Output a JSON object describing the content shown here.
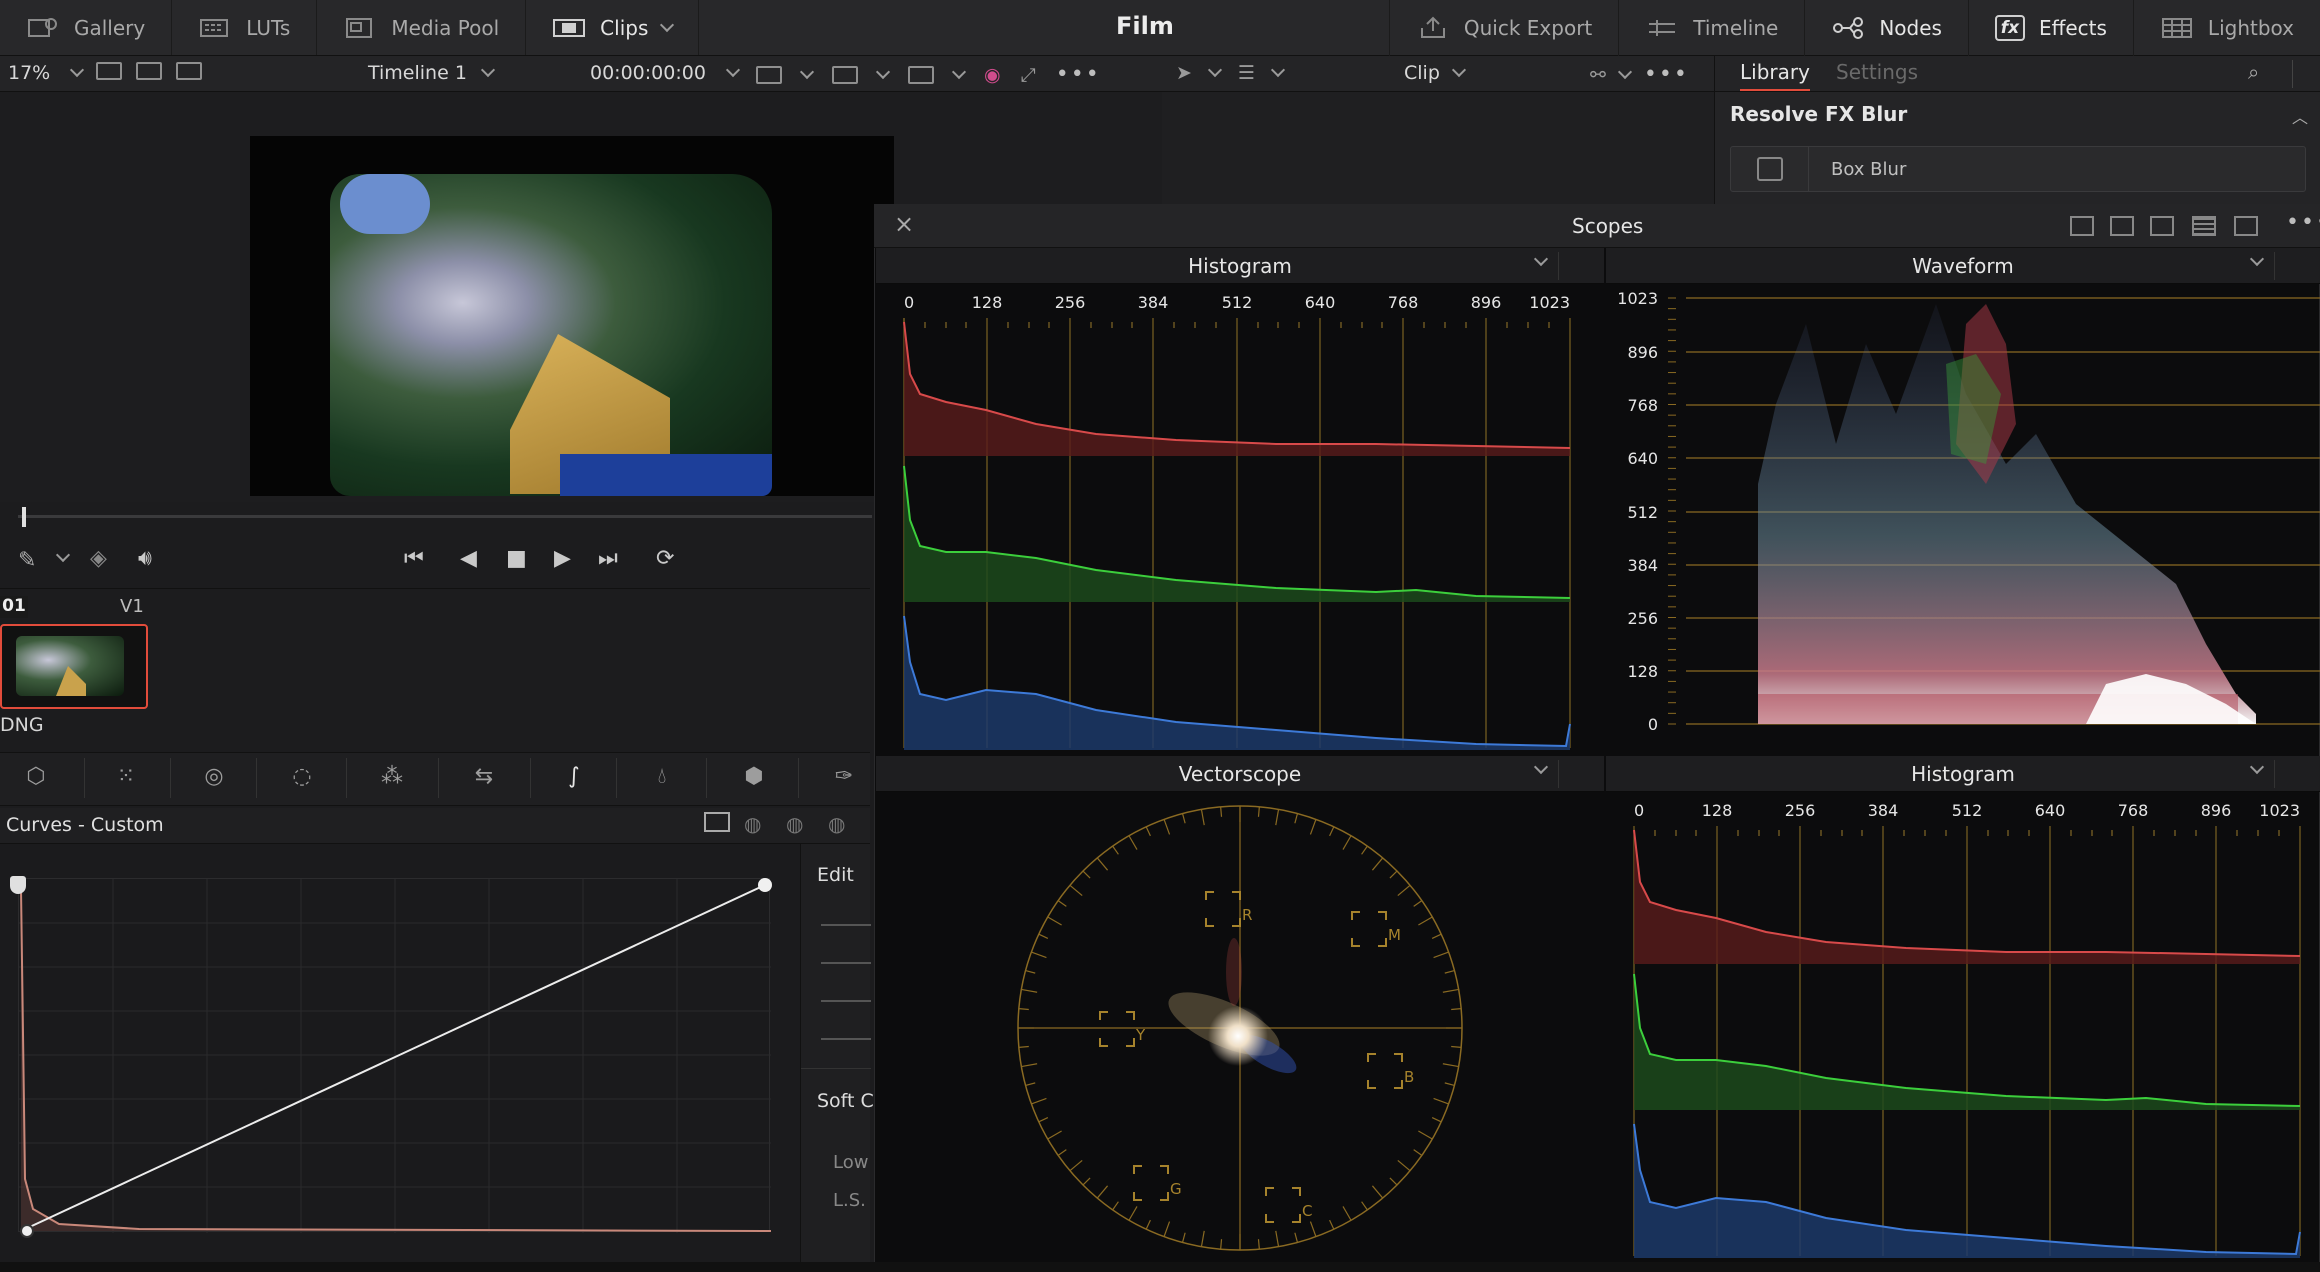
{
  "topbar": {
    "left_items": [
      {
        "label": "Gallery",
        "icon": "gallery-icon"
      },
      {
        "label": "LUTs",
        "icon": "luts-icon"
      },
      {
        "label": "Media Pool",
        "icon": "media-pool-icon"
      },
      {
        "label": "Clips",
        "icon": "clips-icon"
      }
    ],
    "title": "Film",
    "right_items": [
      {
        "label": "Quick Export",
        "icon": "quick-export-icon"
      },
      {
        "label": "Timeline",
        "icon": "timeline-icon"
      },
      {
        "label": "Nodes",
        "icon": "nodes-icon"
      },
      {
        "label": "Effects",
        "icon": "fx-icon"
      },
      {
        "label": "Lightbox",
        "icon": "lightbox-icon"
      }
    ],
    "fx_glyph": "fx"
  },
  "toolbar": {
    "zoom": "17%",
    "timeline_name": "Timeline 1",
    "timecode": "00:00:00:00",
    "node_mode": "Clip"
  },
  "library": {
    "tab_active": "Library",
    "tab_inactive": "Settings",
    "section": "Resolve FX Blur",
    "item": "Box Blur"
  },
  "clips": {
    "number": "01",
    "track": "V1",
    "name": "DNG"
  },
  "curves": {
    "title": "Curves - Custom",
    "side_labels": [
      "Edit",
      "Soft Cl",
      "Low",
      "L.S."
    ]
  },
  "scopes": {
    "title": "Scopes",
    "panels": [
      {
        "title": "Histogram"
      },
      {
        "title": "Waveform"
      },
      {
        "title": "Vectorscope"
      },
      {
        "title": "Histogram"
      }
    ],
    "histogram_ticks": [
      "0",
      "128",
      "256",
      "384",
      "512",
      "640",
      "768",
      "896",
      "1023"
    ],
    "waveform_ticks": [
      "1023",
      "896",
      "768",
      "640",
      "512",
      "384",
      "256",
      "128",
      "0"
    ],
    "vector_targets": [
      "R",
      "M",
      "Y",
      "B",
      "G",
      "C"
    ]
  },
  "colors": {
    "accent_red": "#e24c3b",
    "scope_grid": "#a6832c",
    "hist_red": "#b23030",
    "hist_green": "#2a9a2a",
    "hist_blue": "#2a5ab0"
  }
}
